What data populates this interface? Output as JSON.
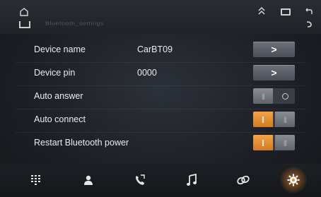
{
  "statusbar": {
    "title": "Bluetooth_settings",
    "icons": [
      "home-icon",
      "chevrons-up-icon",
      "recent-apps-icon",
      "back-icon"
    ]
  },
  "settings": {
    "rows": [
      {
        "label": "Device name",
        "value": "CarBT09",
        "control": "arrow",
        "arrow": ">"
      },
      {
        "label": "Device pin",
        "value": "0000",
        "control": "arrow",
        "arrow": ">"
      },
      {
        "label": "Auto answer",
        "control": "toggle",
        "state": "off"
      },
      {
        "label": "Auto connect",
        "control": "toggle",
        "state": "on"
      },
      {
        "label": "Restart Bluetooth power",
        "control": "toggle",
        "state": "on"
      }
    ]
  },
  "toggle_text": {
    "off_grip": "|||",
    "on_grip": "|||"
  },
  "nav": {
    "items": [
      "dialpad-icon",
      "contacts-icon",
      "call-log-icon",
      "music-icon",
      "link-icon",
      "settings-icon"
    ],
    "active": "settings-icon"
  },
  "colors": {
    "accent": "#f39a3c",
    "button": "#5c6068",
    "background": "#1c1f25"
  }
}
